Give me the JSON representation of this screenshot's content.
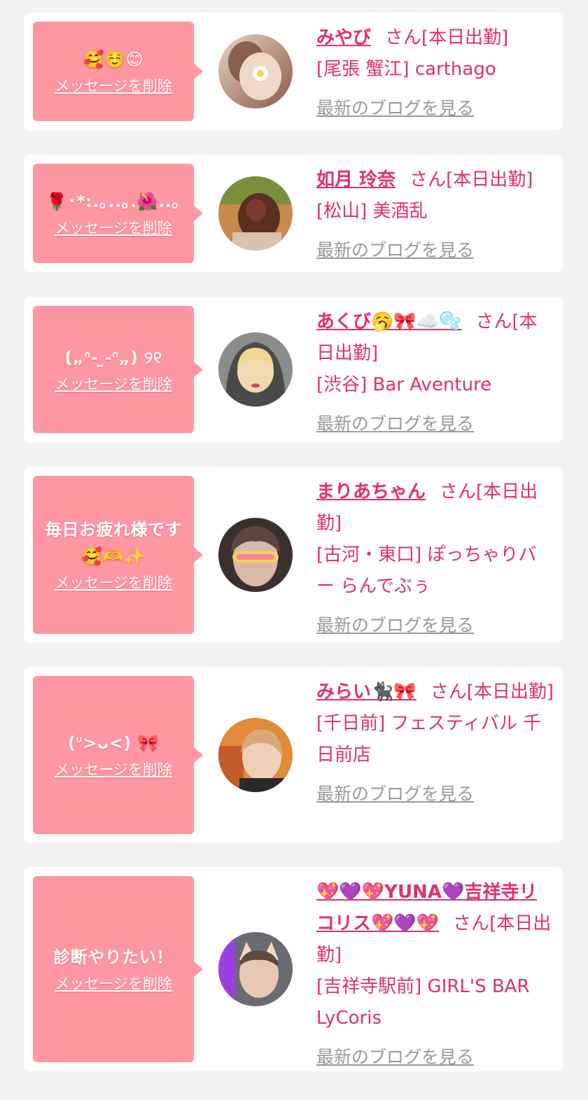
{
  "colors": {
    "background": "#f2f2f2",
    "card": "#ffffff",
    "bubble": "#ff97a3",
    "accent": "#e0306a",
    "link_gray": "#999999"
  },
  "labels": {
    "delete": "メッセージを削除",
    "blog": "最新のブログを見る"
  },
  "items": [
    {
      "message": "🥰☺️😊",
      "name": "みやび",
      "suffix": "さん[本日出勤]",
      "shop": "[尾張 蟹江] carthago",
      "avatar_icon": "avatar-photo-icon"
    },
    {
      "message": "🌹･*:.｡..｡.🌺..｡",
      "name": "如月 玲奈",
      "suffix": "さん[本日出勤]",
      "shop": "[松山] 美酒乱",
      "avatar_icon": "avatar-photo-icon"
    },
    {
      "message": "(„ᐢ- ̫-ᐢ„) ୨୧",
      "name": "あくび🥱🎀☁️🫧",
      "suffix": "さん[本日出勤]",
      "shop": "[渋谷] Bar Aventure",
      "avatar_icon": "avatar-photo-icon"
    },
    {
      "message": "毎日お疲れ様です🥰🫶✨",
      "name": "まりあちゃん",
      "suffix": "さん[本日出勤]",
      "shop": "[古河・東口] ぽっちゃりバー らんでぶぅ",
      "avatar_icon": "avatar-photo-icon"
    },
    {
      "message": "(ᐡ>ᴗ<) 🎀",
      "name": "みらい🐈‍⬛🎀",
      "suffix": "さん[本日出勤]",
      "shop": "[千日前] フェスティバル 千日前店",
      "avatar_icon": "avatar-photo-icon"
    },
    {
      "message": "診断やりたい！",
      "name": "💖💜💖YUNA💜吉祥寺リコリス💖💜💖",
      "suffix": "さん[本日出勤]",
      "shop": "[吉祥寺駅前] GIRL'S BAR LyCoris",
      "avatar_icon": "avatar-photo-icon"
    }
  ]
}
